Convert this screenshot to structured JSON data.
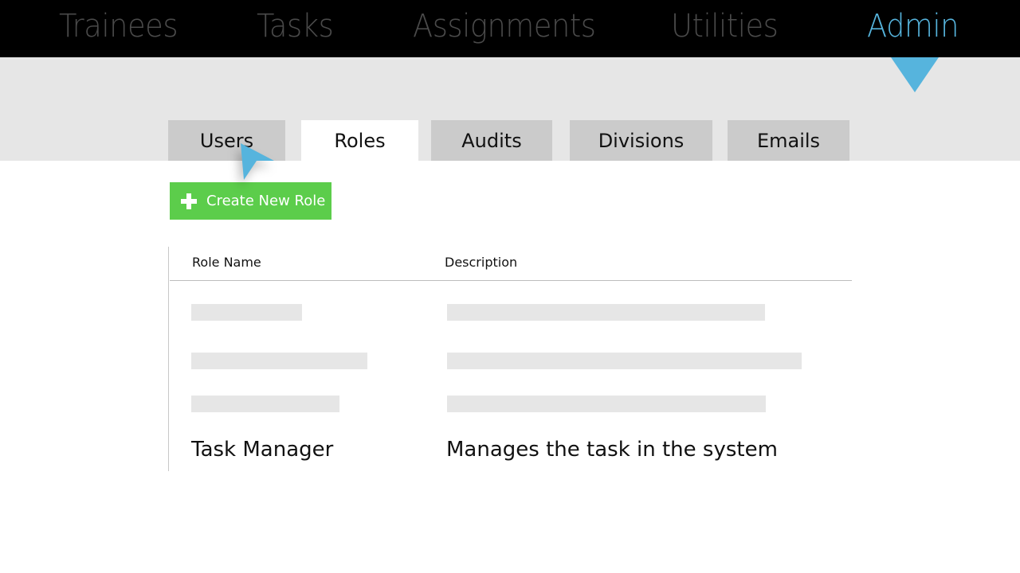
{
  "top_nav": {
    "items": [
      {
        "label": "Trainees",
        "active": false
      },
      {
        "label": "Tasks",
        "active": false
      },
      {
        "label": "Assignments",
        "active": false
      },
      {
        "label": "Utilities",
        "active": false
      },
      {
        "label": "Admin",
        "active": true
      }
    ],
    "active_color": "#56b4dd",
    "inactive_color": "#4a4a4a"
  },
  "sub_tabs": {
    "items": [
      {
        "label": "Users",
        "active": false
      },
      {
        "label": "Roles",
        "active": true
      },
      {
        "label": "Audits",
        "active": false
      },
      {
        "label": "Divisions",
        "active": false
      },
      {
        "label": "Emails",
        "active": false
      }
    ]
  },
  "toolbar": {
    "create_label": "Create New Role",
    "create_icon": "plus-icon",
    "button_color": "#5ccd4b"
  },
  "table": {
    "columns": [
      "Role Name",
      "Description"
    ],
    "placeholder_rows": 3,
    "rows": [
      {
        "role_name": "Task Manager",
        "description": "Manages the task in the system"
      }
    ]
  },
  "cursor": {
    "icon": "pointer-cursor-icon",
    "color": "#56b4dd"
  }
}
